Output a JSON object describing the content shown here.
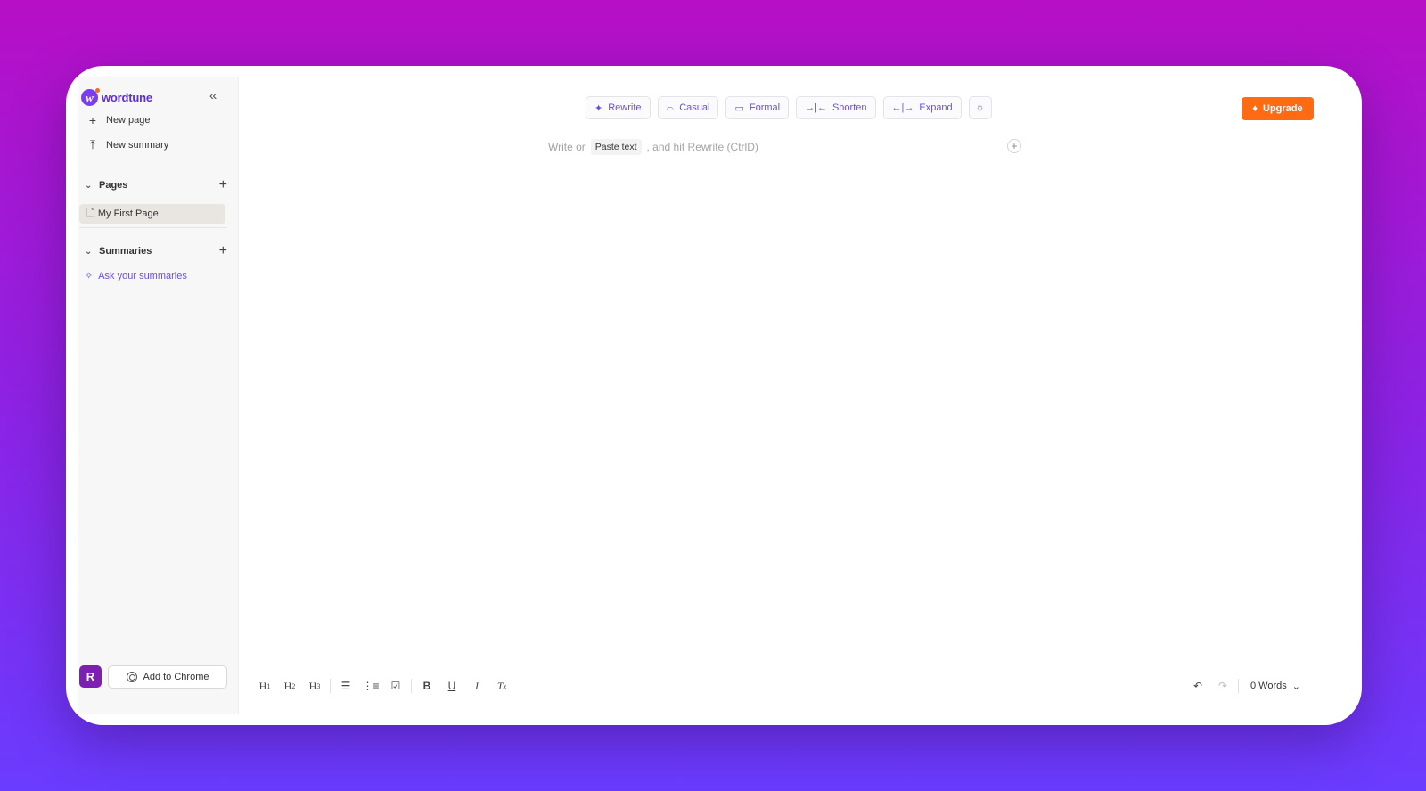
{
  "brand": {
    "name": "wordtune",
    "mark": "w"
  },
  "sidebar": {
    "actions": [
      {
        "icon": "plus-icon",
        "label": "New page"
      },
      {
        "icon": "upload-icon",
        "label": "New summary"
      }
    ],
    "pages_section": {
      "title": "Pages",
      "items": [
        {
          "label": "My First Page"
        }
      ]
    },
    "summaries_section": {
      "title": "Summaries",
      "ask_label": "Ask your summaries"
    },
    "avatar_initial": "R",
    "chrome_label": "Add to Chrome"
  },
  "toolbar": {
    "buttons": [
      {
        "icon": "sparkle-icon",
        "label": "Rewrite"
      },
      {
        "icon": "casual-icon",
        "label": "Casual"
      },
      {
        "icon": "briefcase-icon",
        "label": "Formal"
      },
      {
        "icon": "shorten-icon",
        "label": "Shorten"
      },
      {
        "icon": "expand-icon",
        "label": "Expand"
      }
    ],
    "ideas_icon": "lightbulb-icon",
    "upgrade_label": "Upgrade"
  },
  "editor": {
    "placeholder_prefix": "Write or",
    "paste_chip": "Paste text",
    "placeholder_suffix": ", and hit Rewrite (CtrlD)"
  },
  "format_bar": {
    "headings": [
      "H",
      "H",
      "H"
    ],
    "heading_levels": [
      "1",
      "2",
      "3"
    ]
  },
  "status": {
    "word_count": "0 Words"
  },
  "colors": {
    "accent": "#6b4fe0",
    "upgrade": "#ff6a13",
    "avatar": "#7d1fb3",
    "bg_top": "#b70fc6",
    "bg_bottom": "#6a3cff"
  }
}
